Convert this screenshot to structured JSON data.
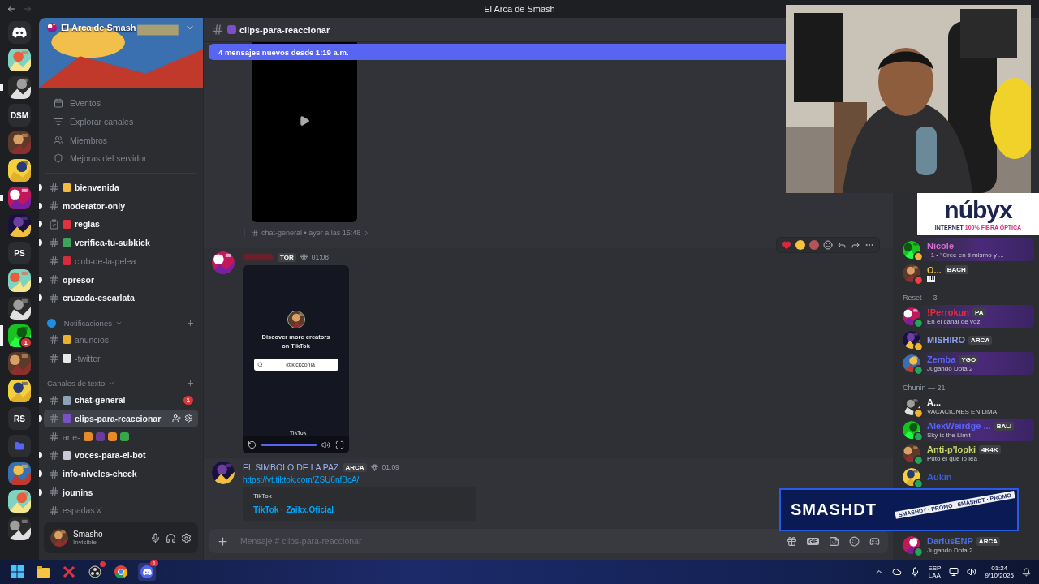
{
  "window": {
    "title": "El Arca de Smash"
  },
  "servers": [
    {
      "kind": "home",
      "selected": false,
      "unread": false
    },
    {
      "kind": "picture",
      "selected": false,
      "unread": false
    },
    {
      "kind": "picture",
      "selected": false,
      "unread": true
    },
    {
      "kind": "text",
      "label": "DSM",
      "selected": false,
      "unread": false
    },
    {
      "kind": "picture",
      "selected": false,
      "unread": false
    },
    {
      "kind": "picture",
      "selected": false,
      "unread": false
    },
    {
      "kind": "picture",
      "selected": false,
      "unread": true
    },
    {
      "kind": "picture",
      "selected": false,
      "unread": false
    },
    {
      "kind": "text",
      "label": "PS",
      "selected": false,
      "unread": false
    },
    {
      "kind": "picture",
      "selected": false,
      "unread": false
    },
    {
      "kind": "picture",
      "selected": false,
      "unread": false
    },
    {
      "kind": "picture",
      "selected": true,
      "unread": false,
      "badge": "1"
    },
    {
      "kind": "picture",
      "selected": false,
      "unread": false
    },
    {
      "kind": "picture",
      "selected": false,
      "unread": false
    },
    {
      "kind": "text",
      "label": "RS",
      "selected": false,
      "unread": false
    },
    {
      "kind": "folder",
      "selected": false,
      "unread": false
    },
    {
      "kind": "picture",
      "selected": false,
      "unread": false
    },
    {
      "kind": "picture",
      "selected": false,
      "unread": false
    },
    {
      "kind": "picture",
      "selected": false,
      "unread": false
    }
  ],
  "server": {
    "name": "El Arca de Smash"
  },
  "menu": [
    {
      "kind": "events",
      "label": "Eventos"
    },
    {
      "kind": "browse",
      "label": "Explorar canales"
    },
    {
      "kind": "members",
      "label": "Miembros"
    },
    {
      "kind": "boost",
      "label": "Mejoras del servidor"
    }
  ],
  "channel_groups": [
    {
      "channels": [
        {
          "kind": "text",
          "name": "bienvenida",
          "color": "#f4b93e",
          "unread": true,
          "selected": false
        },
        {
          "kind": "thread",
          "name": "moderator-only",
          "unread": true,
          "selected": false
        },
        {
          "kind": "rules",
          "name": "reglas",
          "color": "#e0333d",
          "unread": true,
          "selected": false
        },
        {
          "kind": "thread",
          "name": "verifica-tu-subkick",
          "color": "#3ba55c",
          "unread": true,
          "selected": false
        },
        {
          "kind": "text",
          "name": "club-de-la-pelea",
          "color": "#d52b3a",
          "unread": false,
          "selected": false
        },
        {
          "kind": "thread",
          "name": "opresor",
          "unread": true,
          "selected": false
        },
        {
          "kind": "thread",
          "name": "cruzada-escarlata",
          "unread": true,
          "selected": false
        }
      ]
    },
    {
      "title": "- Notificaciones",
      "color": "#1d8fe1",
      "channels": [
        {
          "kind": "text",
          "name": "anuncios",
          "color": "#e8b32c",
          "unread": false,
          "selected": false
        },
        {
          "kind": "text",
          "name": "-twitter",
          "color": "#e9e9e9",
          "unread": false,
          "selected": false
        }
      ]
    },
    {
      "title": "Canales de texto",
      "channels": [
        {
          "kind": "text",
          "name": "chat-general",
          "color": "#8fa3b8",
          "unread": true,
          "selected": false,
          "badge": "1"
        },
        {
          "kind": "text",
          "name": "clips-para-reaccionar",
          "color": "#7a4fc9",
          "unread": true,
          "selected": true
        },
        {
          "kind": "thread",
          "name": "arte-",
          "unread": false,
          "selected": false,
          "suffix_emojis": [
            {
              "color": "#e88a2a"
            },
            {
              "color": "#6a3d9a"
            },
            {
              "color": "#e88a2a"
            },
            {
              "color": "#36a84a"
            }
          ]
        },
        {
          "kind": "text",
          "name": "voces-para-el-bot",
          "color": "#c9c9d6",
          "unread": true,
          "selected": false
        },
        {
          "kind": "text",
          "name": "info-niveles-check",
          "unread": true,
          "selected": false
        },
        {
          "kind": "thread",
          "name": "jounins",
          "unread": true,
          "selected": false
        },
        {
          "kind": "thread",
          "name": "espadas⚔",
          "unread": false,
          "selected": false
        }
      ]
    }
  ],
  "user": {
    "name": "Smasho",
    "status": "Invisible"
  },
  "chat": {
    "channel": "clips-para-reaccionar",
    "new_messages": "4 mensajes nuevos desde 1:19 a.m.",
    "forward_meta": "chat-general • ayer a las 15:48",
    "messages": [
      {
        "kind": "tiktok",
        "badge": "TOR",
        "time": "01:08",
        "toolbar": {
          "reactions": [
            {
              "color": "#e0243d"
            },
            {
              "color": "#f4c33a"
            },
            {
              "color": "#b55555"
            }
          ]
        },
        "embed": {
          "text": "Discover more creators on TikTok",
          "search": "@kickconia",
          "brand": "TikTok",
          "level": 1
        }
      },
      {
        "kind": "link",
        "author": "EL SIMBOLO DE LA PAZ",
        "badge": "ARCA",
        "time": "01:09",
        "link": "https://vt.tiktok.com/ZSU6nfBcA/",
        "embed": {
          "provider": "TikTok",
          "title": "TikTok · Zaikx.Oficial"
        }
      }
    ],
    "composer": {
      "placeholder": "Mensaje # clips-para-reaccionar",
      "gif_label": "GIF"
    }
  },
  "members": [
    {
      "kind": "member",
      "name": "Nicole",
      "color": "#d36bd0",
      "presence": {
        "color": "#f0b232"
      },
      "nameplate": true,
      "activity": "+1 • \"Cree en ti mismo y ..."
    },
    {
      "kind": "member",
      "name": "O...",
      "color": "#f0c050",
      "presence": {
        "color": "#f23f43"
      },
      "nameplate": false,
      "badge": "BACH",
      "activity_emoji": {
        "color": "#f2f3f5"
      }
    },
    {
      "kind": "header",
      "title": "Reset — 3"
    },
    {
      "kind": "member",
      "name": "!Perrokun",
      "color": "#e0303a",
      "presence": {
        "color": "#23a55a"
      },
      "nameplate": true,
      "badge": "PA",
      "activity": "En el canal de voz"
    },
    {
      "kind": "member",
      "name": "MISHIRO",
      "color": "#8fa0ee",
      "presence": {
        "color": "#f0b232"
      },
      "nameplate": false,
      "badge": "ARCA"
    },
    {
      "kind": "member",
      "name": "Zemba",
      "color": "#5865f2",
      "presence": {
        "color": "#23a55a"
      },
      "nameplate": true,
      "badge": "YGO",
      "activity": "Jugando Dota 2"
    },
    {
      "kind": "header",
      "title": "Chunin — 21"
    },
    {
      "kind": "member",
      "name": "A...",
      "color": "#f2f3f5",
      "presence": {
        "color": "#f0b232"
      },
      "nameplate": false,
      "activity": "VACACIONES EN LIMA"
    },
    {
      "kind": "member",
      "name": "AlexWeirdge ...",
      "color": "#5865f2",
      "presence": {
        "color": "#23a55a"
      },
      "nameplate": true,
      "badge": "BALI",
      "activity": "Sky is the Limit"
    },
    {
      "kind": "member",
      "name": "Anti-p'lopki",
      "color": "#c8d66a",
      "presence": {
        "color": "#23a55a"
      },
      "nameplate": false,
      "badge": "4K4K",
      "activity": "Puto el que lo lea"
    },
    {
      "kind": "member",
      "name": "Aukin",
      "color": "#3b5bd9",
      "presence": {
        "color": "#23a55a"
      },
      "nameplate": false
    },
    {
      "kind": "member",
      "name": "DariusENP",
      "color": "#4f6fe0",
      "presence": {
        "color": "#23a55a"
      },
      "nameplate": false,
      "badge": "ARCA",
      "activity": "Jugando Dota 2"
    }
  ],
  "ad": {
    "brand": "núbyx",
    "tagline": "INTERNET",
    "tagline_highlight": "100% FIBRA ÓPTICA"
  },
  "promo": {
    "title": "SMASHDT",
    "ribbon": "SMASHDT · PROMO · SMASHDT · PROMO"
  },
  "taskbar": {
    "apps": [
      {
        "kind": "start"
      },
      {
        "kind": "files"
      },
      {
        "kind": "app"
      },
      {
        "kind": "obs",
        "alert": true
      },
      {
        "kind": "chrome"
      },
      {
        "kind": "discord",
        "badge": "1",
        "selected": true
      }
    ],
    "language": "ESP",
    "layout": "LAA",
    "time": "01:24",
    "date": "9/10/2025"
  }
}
